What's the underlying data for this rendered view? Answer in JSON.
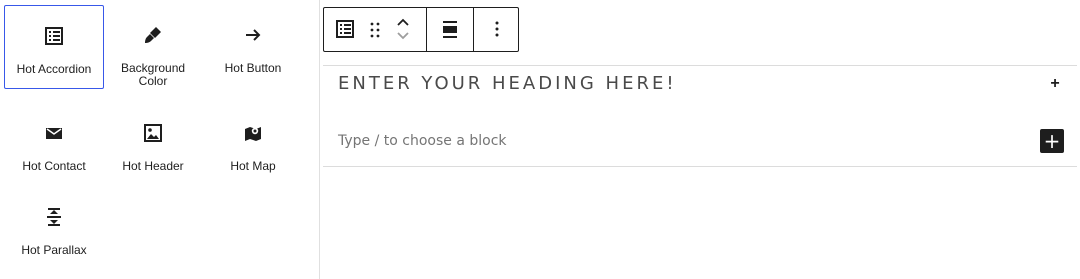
{
  "inserter": {
    "blocks": [
      {
        "label": "Hot Accordion",
        "icon": "list-table-icon",
        "selected": true
      },
      {
        "label": "Background Color",
        "icon": "paintbrush-icon",
        "selected": false
      },
      {
        "label": "Hot Button",
        "icon": "arrow-right-icon",
        "selected": false
      },
      {
        "label": "Hot Contact",
        "icon": "envelope-icon",
        "selected": false
      },
      {
        "label": "Hot Header",
        "icon": "image-icon",
        "selected": false
      },
      {
        "label": "Hot Map",
        "icon": "map-pin-icon",
        "selected": false
      },
      {
        "label": "Hot Parallax",
        "icon": "parallax-icon",
        "selected": false
      }
    ],
    "selected_border_color": "#3858e9"
  },
  "toolbar": {
    "block_type_icon": "list-table-icon",
    "drag_icon": "drag-handle-icon",
    "move_up_icon": "chevron-up-icon",
    "move_down_icon": "chevron-down-icon",
    "align_icon": "align-center-icon",
    "options_icon": "more-vertical-icon"
  },
  "editor": {
    "heading": "ENTER YOUR HEADING HERE!",
    "heading_toggle": "+",
    "placeholder": "Type / to choose a block",
    "add_block": "+"
  }
}
